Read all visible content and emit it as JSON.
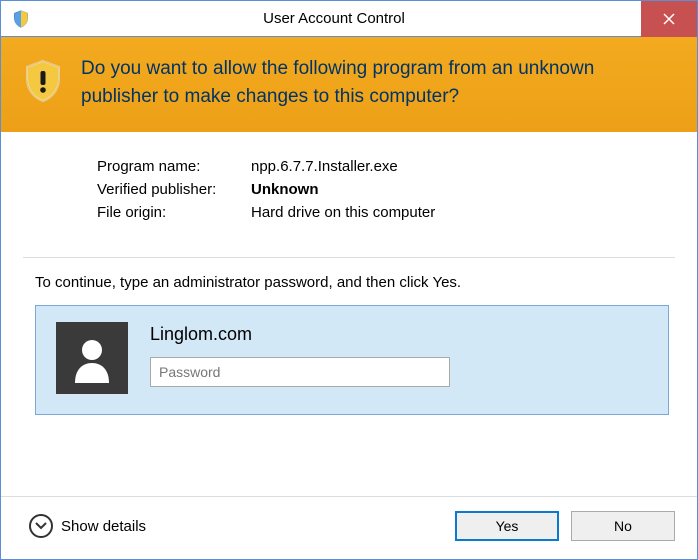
{
  "titlebar": {
    "title": "User Account Control"
  },
  "banner": {
    "text": "Do you want to allow the following program from an unknown publisher to make changes to this computer?"
  },
  "details": {
    "program_name_label": "Program name:",
    "program_name_value": "npp.6.7.7.Installer.exe",
    "publisher_label": "Verified publisher:",
    "publisher_value": "Unknown",
    "origin_label": "File origin:",
    "origin_value": "Hard drive on this computer"
  },
  "instruction": "To continue, type an administrator password, and then click Yes.",
  "credential": {
    "username": "Linglom.com",
    "password_placeholder": "Password"
  },
  "footer": {
    "show_details_label": "Show details",
    "yes_label": "Yes",
    "no_label": "No"
  }
}
